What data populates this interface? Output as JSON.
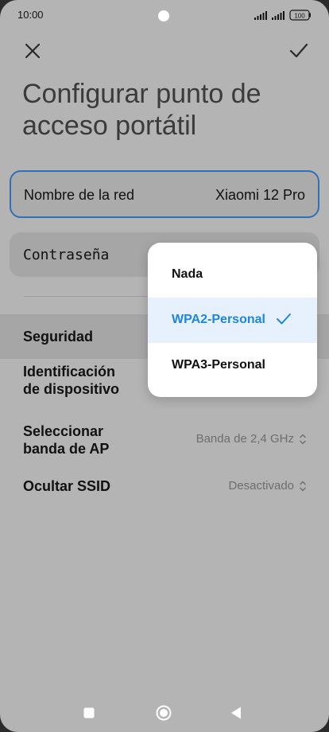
{
  "status_bar": {
    "time": "10:00",
    "battery": "100"
  },
  "header": {
    "title": "Configurar punto de acceso portátil"
  },
  "network_name": {
    "label": "Nombre de la red",
    "value": "Xiaomi 12 Pro"
  },
  "password": {
    "label": "Contraseña",
    "masked": "•"
  },
  "settings": {
    "security_label": "Seguridad",
    "device_id_label": "Identificación de dispositivo",
    "ap_band_label": "Seleccionar banda de AP",
    "ap_band_value": "Banda de 2,4 GHz",
    "hide_ssid_label": "Ocultar SSID",
    "hide_ssid_value": "Desactivado"
  },
  "security_popup": {
    "options": [
      "Nada",
      "WPA2-Personal",
      "WPA3-Personal"
    ],
    "selected": "WPA2-Personal"
  },
  "colors": {
    "accent": "#1e86e0",
    "focus_border": "#2f71b8"
  }
}
